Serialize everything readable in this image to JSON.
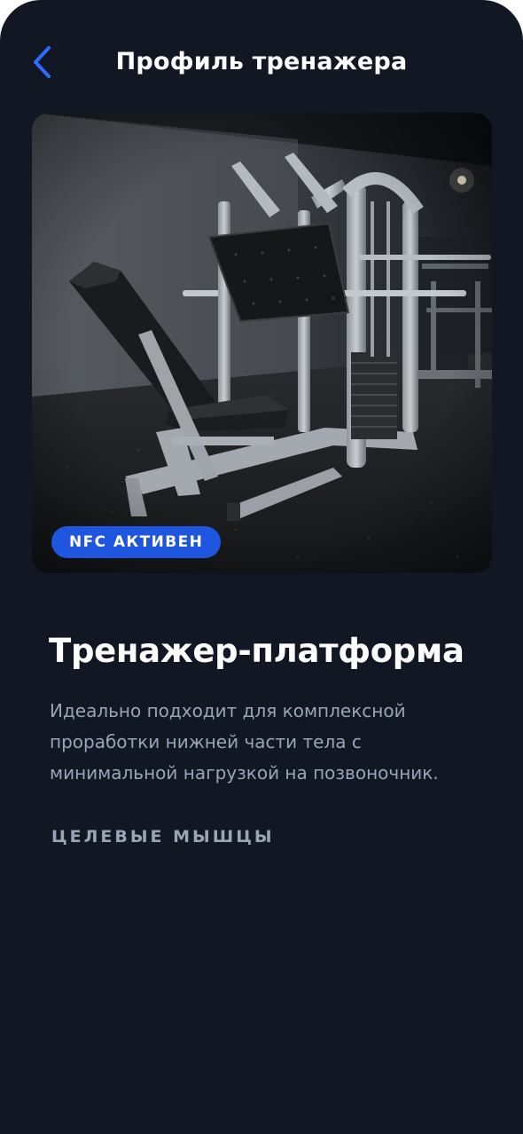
{
  "header": {
    "title": "Профиль тренажера",
    "back_icon": "chevron-left-icon"
  },
  "hero": {
    "image_alt": "Тренажер-платформа",
    "badge": "NFC АКТИВЕН"
  },
  "machine": {
    "title": "Тренажер-платформа",
    "description": "Идеально подходит для комплексной проработки нижней части тела с минимальной нагрузкой на позвоночник."
  },
  "sections": {
    "target_muscles_label": "ЦЕЛЕВЫЕ МЫШЦЫ"
  },
  "colors": {
    "background": "#111723",
    "accent": "#1f56e0",
    "text_primary": "#ffffff",
    "text_secondary": "#9aa4b8"
  }
}
